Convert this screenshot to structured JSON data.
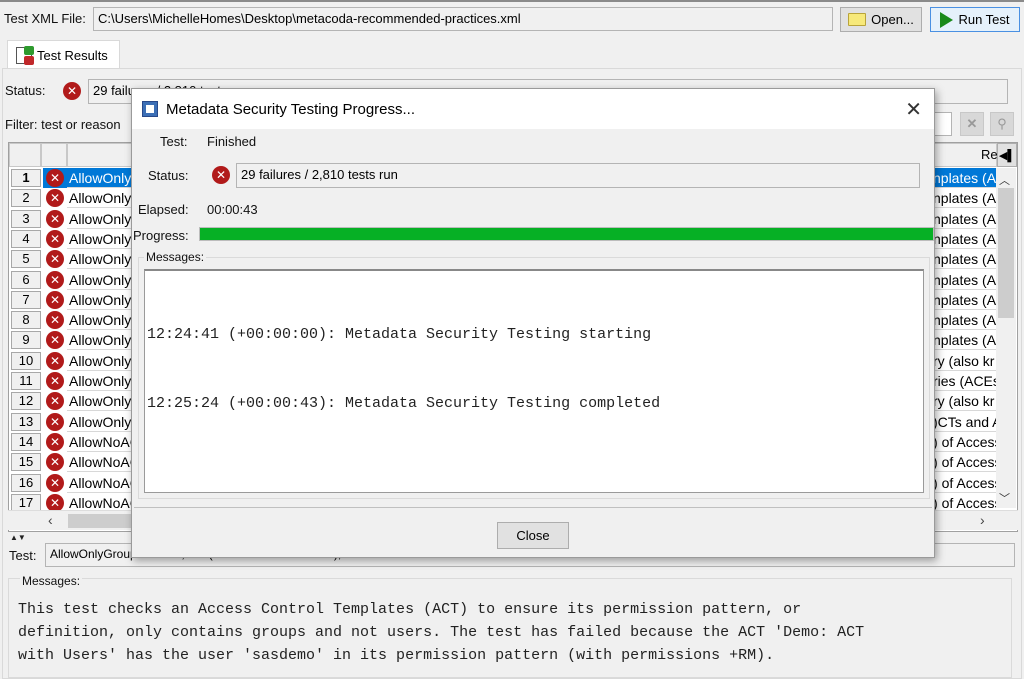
{
  "toolbar": {
    "file_label": "Test XML File:",
    "file_path": "C:\\Users\\MichelleHomes\\Desktop\\metacoda-recommended-practices.xml",
    "open_label": "Open...",
    "run_label": "Run Test"
  },
  "tabs": [
    {
      "label": "Test Results",
      "icon": "test-results-icon"
    }
  ],
  "results": {
    "status_label": "Status:",
    "status_value": "29 failures / 2,810 tests run",
    "filter_label": "Filter: test or reason",
    "reason_header": "Re",
    "rows": [
      {
        "num": "1",
        "name": "AllowOnlyG",
        "reason": "nplates (A",
        "selected": true
      },
      {
        "num": "2",
        "name": "AllowOnlyG",
        "reason": "nplates (A"
      },
      {
        "num": "3",
        "name": "AllowOnlyG",
        "reason": "nplates (A"
      },
      {
        "num": "4",
        "name": "AllowOnlyG",
        "reason": "nplates (A"
      },
      {
        "num": "5",
        "name": "AllowOnlyG",
        "reason": "nplates (A"
      },
      {
        "num": "6",
        "name": "AllowOnlyG",
        "reason": "nplates (A"
      },
      {
        "num": "7",
        "name": "AllowOnlyG",
        "reason": "nplates (A"
      },
      {
        "num": "8",
        "name": "AllowOnlyG",
        "reason": "nplates (A"
      },
      {
        "num": "9",
        "name": "AllowOnlyG",
        "reason": "nplates (A"
      },
      {
        "num": "10",
        "name": "AllowOnlyG",
        "reason": "ry (also kr"
      },
      {
        "num": "11",
        "name": "AllowOnlyG",
        "reason": "ries (ACEs"
      },
      {
        "num": "12",
        "name": "AllowOnlyI",
        "reason": "ry (also kr"
      },
      {
        "num": "13",
        "name": "AllowOnlyI",
        "reason": "CTs and A("
      },
      {
        "num": "14",
        "name": "AllowNoAC",
        "reason": "of Access ("
      },
      {
        "num": "15",
        "name": "AllowNoAC",
        "reason": "of Access ("
      },
      {
        "num": "16",
        "name": "AllowNoAC",
        "reason": "of Access ("
      },
      {
        "num": "17",
        "name": "AllowNoAC",
        "reason": "of Access ("
      }
    ]
  },
  "detail": {
    "test_label": "Test:",
    "test_value": "AllowOnlyGroupsInACTs,ACT(Demo: ACT with Users),sasdemo",
    "messages_label": "Messages:",
    "messages_text": "This test checks an Access Control Templates (ACT) to ensure its permission pattern, or\ndefinition, only contains groups and not users. The test has failed because the ACT 'Demo: ACT\nwith Users' has the user 'sasdemo' in its permission pattern (with permissions +RM)."
  },
  "dialog": {
    "title": "Metadata Security Testing Progress...",
    "test_label": "Test:",
    "test_value": "Finished",
    "status_label": "Status:",
    "status_value": "29 failures / 2,810 tests run",
    "elapsed_label": "Elapsed:",
    "elapsed_value": "00:00:43",
    "progress_label": "Progress:",
    "progress_percent": 100,
    "messages_label": "Messages:",
    "messages": [
      "12:24:41 (+00:00:00): Metadata Security Testing starting",
      "12:25:24 (+00:00:43): Metadata Security Testing completed"
    ],
    "close_label": "Close"
  },
  "colors": {
    "error": "#b11a1a",
    "progress": "#06b025",
    "selection": "#0078d7",
    "run_icon": "#1a8a1a"
  }
}
